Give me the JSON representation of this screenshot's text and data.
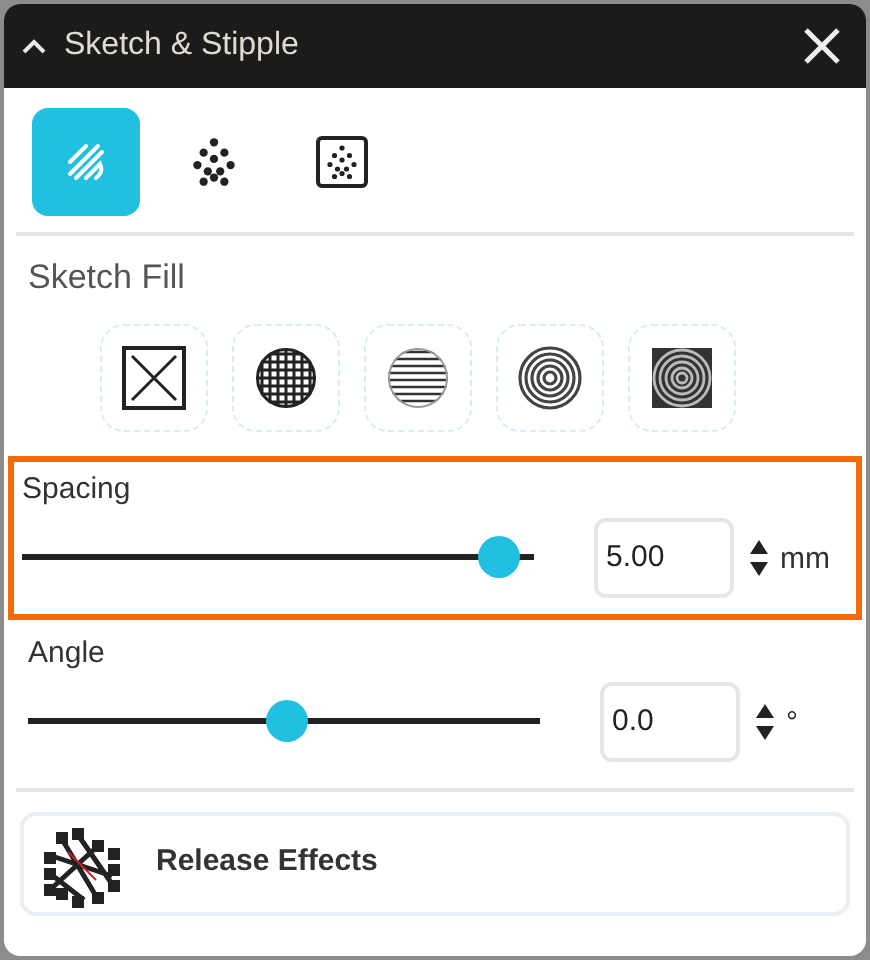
{
  "panel": {
    "title": "Sketch & Stipple",
    "expanded": true
  },
  "modes": [
    {
      "kind": "sketch",
      "selected": true
    },
    {
      "kind": "stipple",
      "selected": false
    },
    {
      "kind": "stipple-box",
      "selected": false
    }
  ],
  "fill": {
    "label": "Sketch Fill",
    "patterns": [
      {
        "kind": "cross-box"
      },
      {
        "kind": "grid"
      },
      {
        "kind": "lines"
      },
      {
        "kind": "rings"
      },
      {
        "kind": "square-rings"
      }
    ]
  },
  "settings": [
    {
      "label": "Spacing",
      "level": 0.96,
      "value": "5.00",
      "unit": "mm",
      "highlighted": true
    },
    {
      "label": "Angle",
      "level": 0.5,
      "value": "0.0",
      "unit": "°",
      "highlighted": false
    }
  ],
  "release_button": "Release Effects"
}
